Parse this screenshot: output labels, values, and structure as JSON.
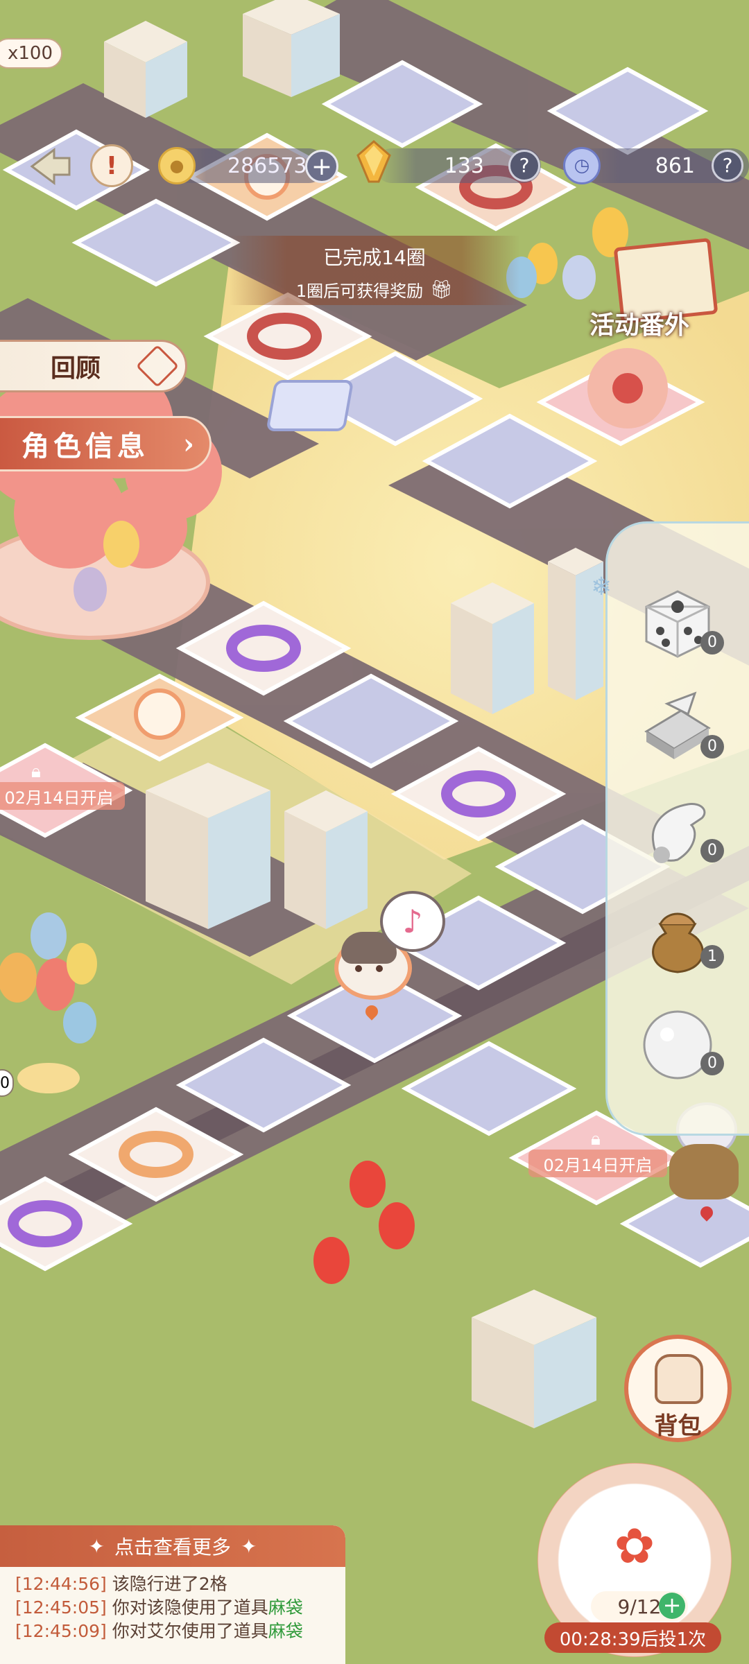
{
  "hud": {
    "ticket_count": "x100",
    "coins": "286573",
    "gems": "133",
    "stamina": "861",
    "plus_symbol": "+",
    "help_symbol": "?",
    "alert_symbol": "!"
  },
  "progress": {
    "laps_completed": "已完成14圈",
    "reward_hint": "1圈后可获得奖励"
  },
  "side_menu": {
    "review_label": "回顾",
    "character_info_label": "角色信息"
  },
  "event_banner": {
    "label": "活动番外"
  },
  "locked_tiles": [
    {
      "label": "02月14日开启"
    },
    {
      "label": "02月14日开启"
    }
  ],
  "edge_counter": "0",
  "items": [
    {
      "name": "dice",
      "count": "0"
    },
    {
      "name": "arrow-tile",
      "count": "0"
    },
    {
      "name": "glove",
      "count": "0"
    },
    {
      "name": "sack",
      "count": "1"
    },
    {
      "name": "snowball",
      "count": "0"
    }
  ],
  "backpack": {
    "label": "背包"
  },
  "roll": {
    "counter": "9/12",
    "timer": "00:28:39后投1次"
  },
  "log": {
    "header": "点击查看更多",
    "entries": [
      {
        "time": "[12:44:56]",
        "text": "该隐行进了2格",
        "highlight": ""
      },
      {
        "time": "[12:45:05]",
        "text": "你对该隐使用了道具",
        "highlight": "麻袋"
      },
      {
        "time": "[12:45:09]",
        "text": "你对艾尔使用了道具",
        "highlight": "麻袋"
      }
    ]
  },
  "colors": {
    "grass": "#a9bc6b",
    "road": "#7d6c72",
    "tile_blue": "#c7c9e6",
    "tile_peach": "#f6d9c6",
    "accent_orange": "#d6734d",
    "ring_red": "#c9534d",
    "ring_purple": "#a068d8",
    "ring_orange": "#f0a86e"
  }
}
